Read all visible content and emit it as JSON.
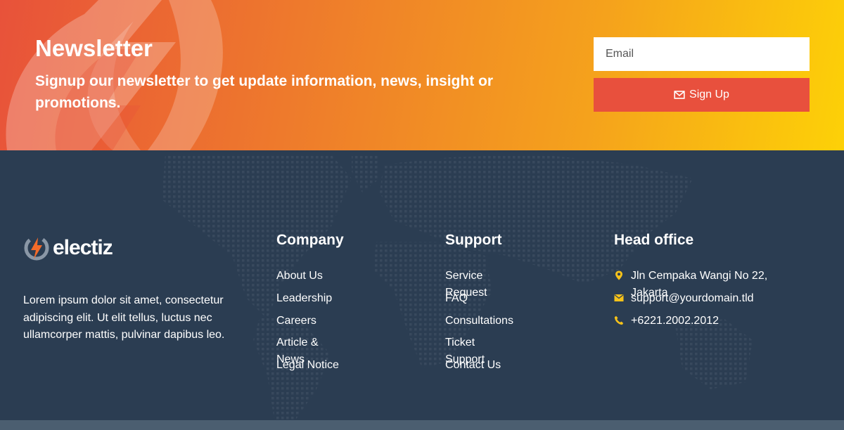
{
  "newsletter": {
    "title": "Newsletter",
    "subtitle": "Signup our newsletter to get update information, news, insight or promotions.",
    "email_placeholder": "Email",
    "signup_label": "Sign Up"
  },
  "brand": {
    "name": "electiz",
    "description": "Lorem ipsum dolor sit amet, consectetur adipiscing elit. Ut elit tellus, luctus nec ullamcorper mattis, pulvinar dapibus leo."
  },
  "company": {
    "title": "Company",
    "links": [
      "About Us",
      "Leadership",
      "Careers",
      "Article & News",
      "Legal Notice"
    ]
  },
  "support": {
    "title": "Support",
    "links": [
      "Service Request",
      "FAQ",
      "Consultations",
      "Ticket Support",
      "Contact Us"
    ]
  },
  "head_office": {
    "title": "Head office",
    "address": "Jln Cempaka Wangi No 22, Jakarta",
    "email": "support@yourdomain.tld",
    "phone": "+6221.2002.2012"
  },
  "colors": {
    "accent_red": "#e8503d",
    "accent_yellow": "#fdd107",
    "footer_bg": "#2b3d52",
    "icon_yellow": "#f6c21a"
  },
  "icons": {
    "signup": "envelope-icon",
    "address": "map-marker-icon",
    "email": "envelope-icon",
    "phone": "phone-icon"
  }
}
